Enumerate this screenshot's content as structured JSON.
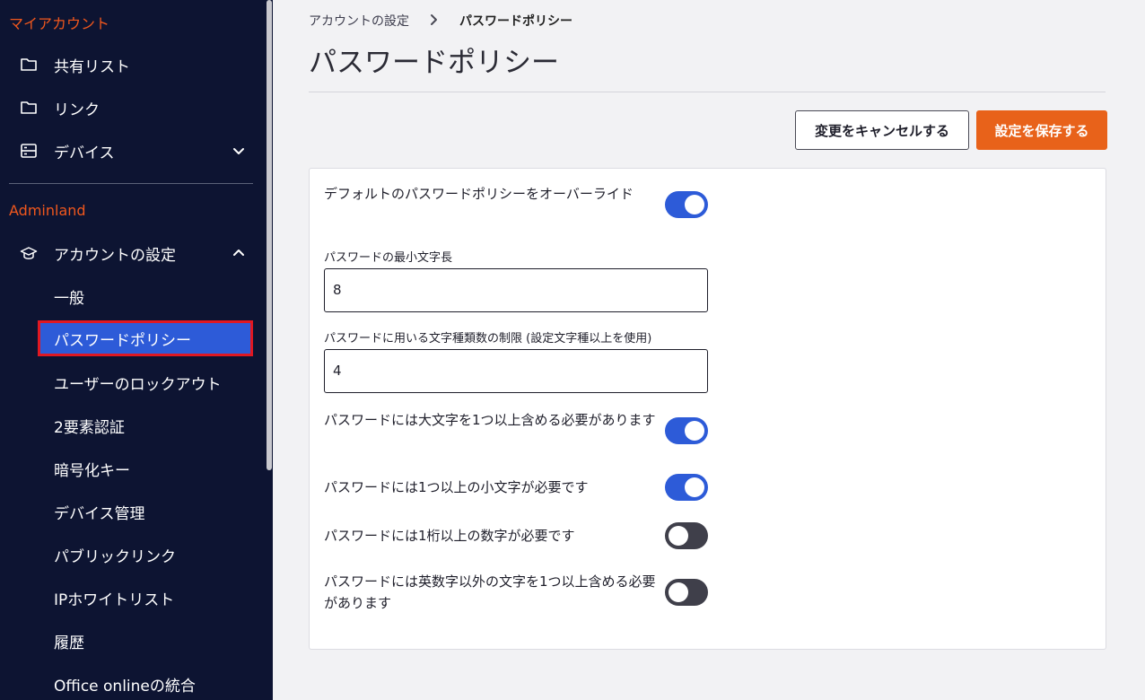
{
  "sidebar": {
    "my_account_title": "マイアカウント",
    "my_account_items": [
      {
        "label": "共有リスト",
        "icon": "folder-icon"
      },
      {
        "label": "リンク",
        "icon": "folder-icon"
      },
      {
        "label": "デバイス",
        "icon": "server-icon"
      }
    ],
    "adminland_title": "Adminland",
    "account_settings": {
      "label": "アカウントの設定",
      "icon": "graduation-cap-icon"
    },
    "sub_items": [
      {
        "label": "一般"
      },
      {
        "label": "パスワードポリシー",
        "active": true
      },
      {
        "label": "ユーザーのロックアウト"
      },
      {
        "label": "2要素認証"
      },
      {
        "label": "暗号化キー"
      },
      {
        "label": "デバイス管理"
      },
      {
        "label": "パブリックリンク"
      },
      {
        "label": "IPホワイトリスト"
      },
      {
        "label": "履歴"
      },
      {
        "label": "Office onlineの統合"
      }
    ]
  },
  "breadcrumb": {
    "parent": "アカウントの設定",
    "current": "パスワードポリシー"
  },
  "page": {
    "title": "パスワードポリシー"
  },
  "actions": {
    "cancel_label": "変更をキャンセルする",
    "save_label": "設定を保存する"
  },
  "policy": {
    "override": {
      "label": "デフォルトのパスワードポリシーをオーバーライド",
      "enabled": true
    },
    "min_length": {
      "label": "パスワードの最小文字長",
      "value": "8"
    },
    "char_types": {
      "label": "パスワードに用いる文字種類数の制限 (設定文字種以上を使用)",
      "value": "4"
    },
    "uppercase": {
      "label": "パスワードには大文字を1つ以上含める必要があります",
      "enabled": true
    },
    "lowercase": {
      "label": "パスワードには1つ以上の小文字が必要です",
      "enabled": true
    },
    "digit": {
      "label": "パスワードには1桁以上の数字が必要です",
      "enabled": false
    },
    "special": {
      "label": "パスワードには英数字以外の文字を1つ以上含める必要があります",
      "enabled": false
    }
  },
  "colors": {
    "sidebar_bg": "#0d1432",
    "accent_orange": "#e8621a",
    "toggle_on": "#2d5bd8",
    "toggle_off": "#3f3f4a",
    "highlight_border": "#e01822"
  }
}
